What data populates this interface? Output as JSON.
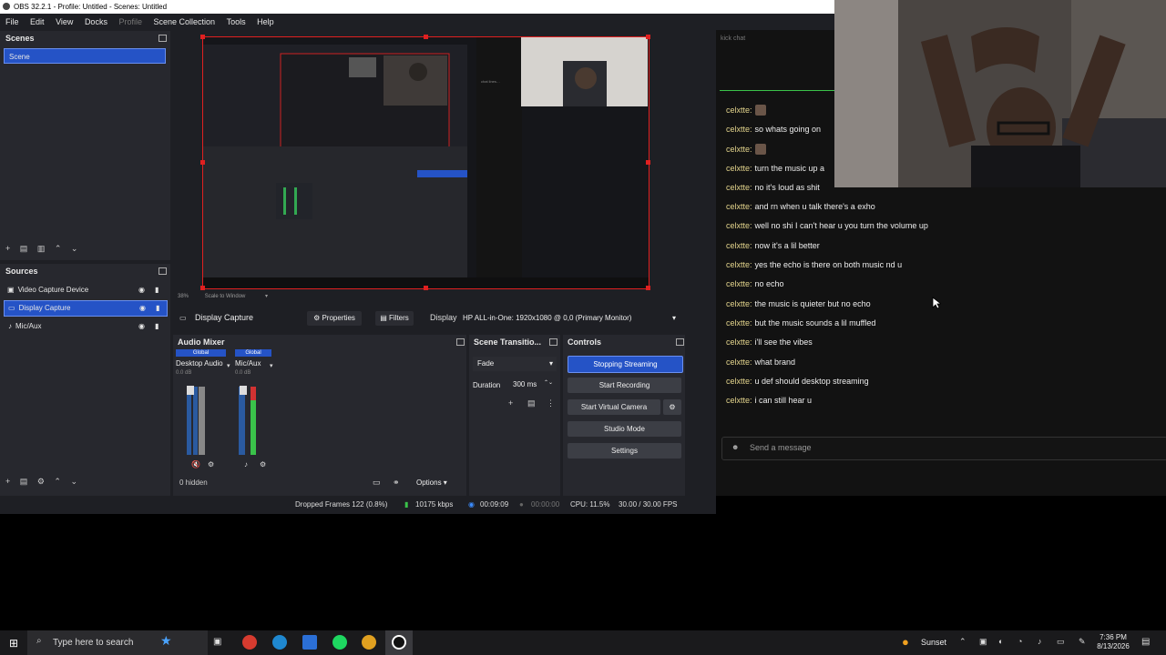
{
  "window": {
    "title": "OBS 32.2.1 - Profile: Untitled - Scenes: Untitled"
  },
  "menu": [
    "File",
    "Edit",
    "View",
    "Docks",
    "Profile",
    "Scene Collection",
    "Tools",
    "Help"
  ],
  "scenes": {
    "title": "Scenes",
    "items": [
      "Scene"
    ]
  },
  "sources": {
    "title": "Sources",
    "items": [
      "Video Capture Device",
      "Display Capture",
      "Mic/Aux"
    ]
  },
  "context_bar": {
    "source_name": "Display Capture",
    "properties": "Properties",
    "filters": "Filters",
    "display_label": "Display",
    "display_value": "HP ALL-in-One: 1920x1080 @ 0,0 (Primary Monitor)"
  },
  "audio_mixer": {
    "title": "Audio Mixer",
    "channels": [
      {
        "global": "Global",
        "name": "Desktop Audio",
        "db": "0.0 dB"
      },
      {
        "global": "Global",
        "name": "Mic/Aux",
        "db": "0.0 dB"
      }
    ],
    "hidden": "0 hidden",
    "options": "Options"
  },
  "transitions": {
    "title": "Scene Transitio...",
    "type": "Fade",
    "duration_label": "Duration",
    "duration_value": "300 ms"
  },
  "controls": {
    "title": "Controls",
    "stop_streaming": "Stopping Streaming",
    "start_recording": "Start Recording",
    "virtual_camera": "Start Virtual Camera",
    "studio_mode": "Studio Mode",
    "settings": "Settings"
  },
  "status": {
    "dropped": "Dropped Frames 122 (0.8%)",
    "kbps": "10175 kbps",
    "stream_time": "00:09:09",
    "rec_time": "00:00:00",
    "cpu": "CPU: 11.5%",
    "fps": "30.00 / 30.00 FPS"
  },
  "preview": {
    "zoom": "38%",
    "scale": "Scale to Window"
  },
  "chat": {
    "header": "kick chat",
    "messages": [
      {
        "user": "celxtte:",
        "text": ""
      },
      {
        "user": "celxtte:",
        "text": "so whats going on"
      },
      {
        "user": "celxtte:",
        "text": ""
      },
      {
        "user": "celxtte:",
        "text": "turn the music up a"
      },
      {
        "user": "celxtte:",
        "text": "no it's loud as shit"
      },
      {
        "user": "celxtte:",
        "text": "and rn when u talk there's a exho"
      },
      {
        "user": "celxtte:",
        "text": "well no shi I can't hear u you turn the volume up"
      },
      {
        "user": "celxtte:",
        "text": "now it's a lil better"
      },
      {
        "user": "celxtte:",
        "text": "yes the echo is there on both music nd u"
      },
      {
        "user": "celxtte:",
        "text": "no echo"
      },
      {
        "user": "celxtte:",
        "text": "the music is quieter but no echo"
      },
      {
        "user": "celxtte:",
        "text": "but the music sounds a lil muffled"
      },
      {
        "user": "celxtte:",
        "text": "i'll see the vibes"
      },
      {
        "user": "celxtte:",
        "text": "what brand"
      },
      {
        "user": "celxtte:",
        "text": "u def should desktop streaming"
      },
      {
        "user": "celxtte:",
        "text": "i can still hear u"
      }
    ],
    "input_placeholder": "Send a message"
  },
  "taskbar": {
    "search_placeholder": "Type here to search",
    "weather": "Sunset",
    "time": "7:36 PM",
    "date": "8/13/2026"
  },
  "colors": {
    "accent": "#2553c6",
    "chat_user": "#e3d48c",
    "recording_red": "#e02020"
  }
}
